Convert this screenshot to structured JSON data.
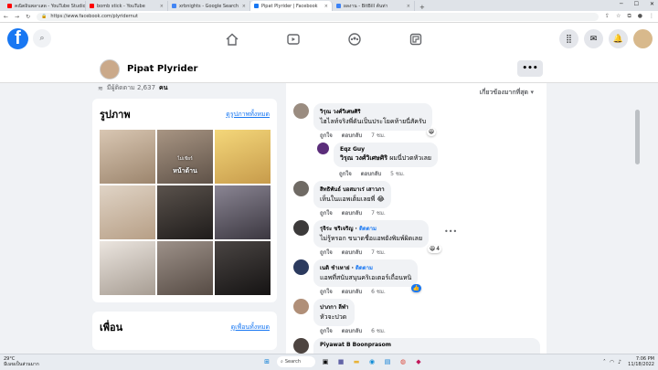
{
  "browser": {
    "tabs": [
      {
        "label": "คณิตอินพลาเสด - YouTube Studio",
        "color": "#ff0000",
        "active": false
      },
      {
        "label": "bomb stick - YouTube",
        "color": "#ff0000",
        "active": false
      },
      {
        "label": "xrbnights - Google Search",
        "color": "#4285f4",
        "active": false
      },
      {
        "label": "Pipat Plyrider | Facebook",
        "color": "#1877f2",
        "active": true
      },
      {
        "label": "ผลงาน - BitBill ต้นท่า",
        "color": "#3b82f6",
        "active": false
      }
    ],
    "new_tab": "+",
    "url": "https://www.facebook.com/plyridernut"
  },
  "facebook": {
    "logo": "f",
    "profile_name": "Pipat Plyrider",
    "more_button": "•••",
    "followers_label": "มีผู้ติดตาม 2,637 คน",
    "followers_pre": "มีผู้ติดตาม 2,637",
    "followers_unit": "คน",
    "photos": {
      "title": "รูปภาพ",
      "see_all": "ดูรูปภาพทั้งหมด",
      "items": [
        {
          "color": "#b8a58e",
          "caption": ""
        },
        {
          "color": "#8a7b6c",
          "caption": "หน้าด้าน",
          "caption_top": "ไม่เชียร์"
        },
        {
          "color": "#e9c56a",
          "caption": ""
        },
        {
          "color": "#c9b9a5",
          "caption": ""
        },
        {
          "color": "#3d3936",
          "caption": ""
        },
        {
          "color": "#5e5a63",
          "caption": ""
        },
        {
          "color": "#cfc7c0",
          "caption": ""
        },
        {
          "color": "#7a6e66",
          "caption": ""
        },
        {
          "color": "#2e2b2a",
          "caption": ""
        }
      ]
    },
    "friends": {
      "title": "เพื่อน",
      "see_all": "ดูเพื่อนทั้งหมด"
    },
    "comments_sort": "เกี่ยวข้องมากที่สุด",
    "comments": [
      {
        "name": "วิรุณ วงศ์วิเศษศิริ",
        "text": "ไฮไลท์จริงพี่ดันเป็นประโยคท้ายนี่สัครับ",
        "time": "7 ชม.",
        "like": "ถูกใจ",
        "reply": "ตอบกลับ",
        "react": "😆"
      },
      {
        "name": "Eqz Guy",
        "mention": "วิรุณ วงศ์วิเศษศิริ",
        "text": "ผมนี่ปวดหัวเลย",
        "time": "5 ชม.",
        "like": "ถูกใจ",
        "reply": "ตอบกลับ"
      },
      {
        "name": "สิทธิพันธ์ บอสมาเร่ เสาวภา",
        "text": "เห็นในแอพเต็มเลยพี่ 😂",
        "time": "7 ชม.",
        "like": "ถูกใจ",
        "reply": "ตอบกลับ"
      },
      {
        "name": "รุจิระ ชริเจริญ",
        "tag": "ติดตาม",
        "text": "ไม่รู้หรอก ขนาดชื่อแอพยังพิมพ์ผิดเลย",
        "time": "7 ชม.",
        "like": "ถูกใจ",
        "reply": "ตอบกลับ",
        "react": "😆",
        "react_count": "4"
      },
      {
        "name": "เนติ ชำเหาย่",
        "tag": "ติดตาม",
        "text": "แอพที่สนับสนุนคริเอเตอร์เถื่อนหนิ",
        "time": "6 ชม.",
        "like": "ถูกใจ",
        "reply": "ตอบกลับ",
        "react": "👍"
      },
      {
        "name": "ปาภกา ลีฬา",
        "text": "หัวจะปวด",
        "time": "6 ชม.",
        "like": "ถูกใจ",
        "reply": "ตอบกลับ"
      },
      {
        "name": "Piyawat B Boonprasom",
        "text": "",
        "time": "",
        "like": "",
        "reply": ""
      }
    ]
  },
  "taskbar": {
    "weather_temp": "29°C",
    "weather_desc": "มีเมฆเป็นส่วนมาก",
    "search": "Search",
    "time": "7:06 PM",
    "date": "11/18/2022"
  }
}
